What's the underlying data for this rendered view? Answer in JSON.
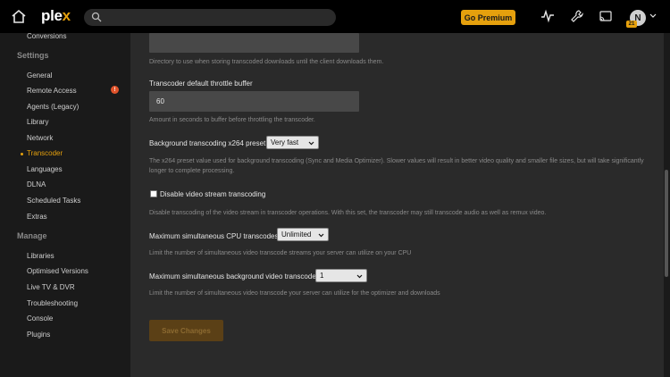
{
  "topbar": {
    "logo_main": "ple",
    "logo_x": "x",
    "search_placeholder": "",
    "premium_label": "Go Premium",
    "avatar_initial": "N",
    "avatar_badge": "21",
    "icons": [
      "home-icon",
      "search-icon",
      "activity-icon",
      "wrench-icon",
      "cast-icon",
      "chevron-down-icon"
    ]
  },
  "sidebar": {
    "conversions": "Conversions",
    "settings_heading": "Settings",
    "settings_items": [
      "General",
      "Remote Access",
      "Agents (Legacy)",
      "Library",
      "Network",
      "Transcoder",
      "Languages",
      "DLNA",
      "Scheduled Tasks",
      "Extras"
    ],
    "active_item": "Transcoder",
    "remote_access_alert": "!",
    "manage_heading": "Manage",
    "manage_items": [
      "Libraries",
      "Optimised Versions",
      "Live TV & DVR",
      "Troubleshooting",
      "Console",
      "Plugins"
    ]
  },
  "main": {
    "download_dir_value": "",
    "download_dir_hint": "Directory to use when storing transcoded downloads until the client downloads them.",
    "throttle_label": "Transcoder default throttle buffer",
    "throttle_value": "60",
    "throttle_hint": "Amount in seconds to buffer before throttling the transcoder.",
    "x264_label": "Background transcoding x264 preset",
    "x264_value": "Very fast",
    "x264_hint": "The x264 preset value used for background transcoding (Sync and Media Optimizer). Slower values will result in better video quality and smaller file sizes, but will take significantly longer to complete processing.",
    "disable_video_label": "Disable video stream transcoding",
    "disable_video_checked": false,
    "disable_video_hint": "Disable transcoding of the video stream in transcoder operations. With this set, the transcoder may still transcode audio as well as remux video.",
    "cpu_label": "Maximum simultaneous CPU transcodes",
    "cpu_value": "Unlimited",
    "cpu_hint": "Limit the number of simultaneous video transcode streams your server can utilize on your CPU",
    "bg_label": "Maximum simultaneous background video transcode",
    "bg_value": "1",
    "bg_hint": "Limit the number of simultaneous video transcode your server can utilize for the optimizer and downloads",
    "save_label": "Save Changes"
  },
  "colors": {
    "accent": "#e5a00d",
    "alert": "#e0532b",
    "panel": "#2a2a2a",
    "sidebar": "#1a1a1a"
  }
}
